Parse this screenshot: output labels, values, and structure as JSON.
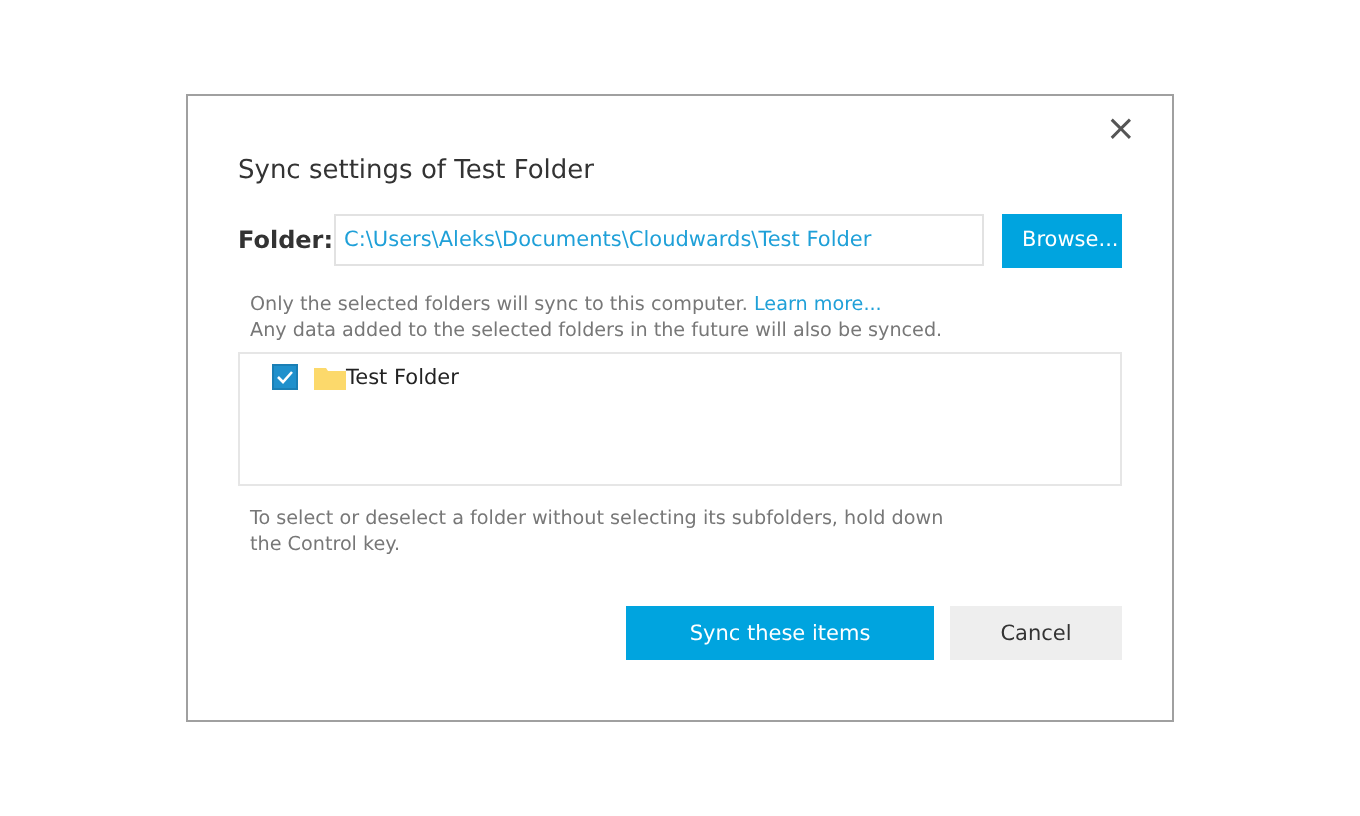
{
  "dialog": {
    "title": "Sync settings of Test Folder",
    "close": "×"
  },
  "folder": {
    "label": "Folder:",
    "value": "C:\\Users\\Aleks\\Documents\\Cloudwards\\Test Folder",
    "browse": "Browse..."
  },
  "notice": {
    "text": "Only the selected folders will sync to this computer.",
    "link": "Learn more...",
    "second_line": "Any data added to the selected folders in the future will also be synced."
  },
  "tree": [
    {
      "label": "Test Folder",
      "checked": true
    }
  ],
  "hint": "To select or deselect a folder without selecting its subfolders, hold down the Control key.",
  "buttons": [
    {
      "label": "Sync these items",
      "kind": "primary"
    },
    {
      "label": "Cancel",
      "kind": "secondary"
    }
  ]
}
